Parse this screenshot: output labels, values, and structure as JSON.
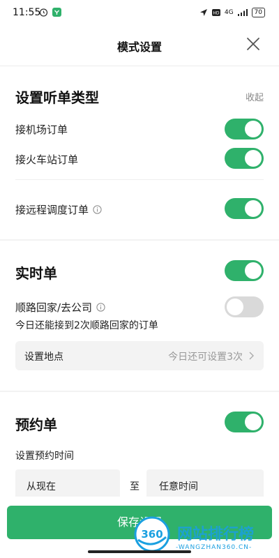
{
  "status_bar": {
    "time": "11:55",
    "network": "4G",
    "battery": "70"
  },
  "header": {
    "title": "模式设置"
  },
  "order_types": {
    "title": "设置听单类型",
    "collapse": "收起",
    "airport": "接机场订单",
    "train": "接火车站订单",
    "remote": "接远程调度订单"
  },
  "realtime": {
    "title": "实时单",
    "home_route": "顺路回家/去公司",
    "home_route_hint": "今日还能接到2次顺路回家的订单",
    "location_label": "设置地点",
    "location_value": "今日还可设置3次"
  },
  "booking": {
    "title": "预约单",
    "time_label": "设置预约时间",
    "from": "从现在",
    "to_sep": "至",
    "until": "任意时间"
  },
  "footer": {
    "save": "保存设置"
  },
  "watermark": {
    "logo": "360",
    "name": "网站排行榜",
    "url": "-WANGZHAN360.CN-"
  },
  "toggles": {
    "airport": true,
    "train": true,
    "remote": true,
    "realtime": true,
    "home_route": false,
    "booking": true
  },
  "colors": {
    "accent": "#2fb16b",
    "toggle_off": "#d9d9d9"
  }
}
